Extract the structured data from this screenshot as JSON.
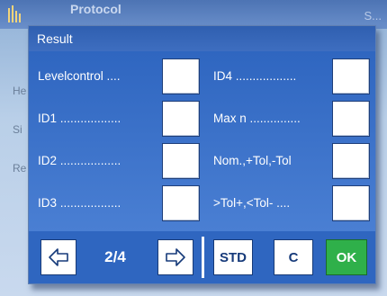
{
  "background_app": {
    "title": "Protocol",
    "title_right": "S...",
    "rows": [
      "He",
      "Si",
      "Re"
    ]
  },
  "dialog": {
    "title": "Result",
    "params_left": [
      {
        "label": "Levelcontrol ....",
        "checked": false
      },
      {
        "label": "ID1 ..................",
        "checked": false
      },
      {
        "label": "ID2 ..................",
        "checked": false
      },
      {
        "label": "ID3 ..................",
        "checked": false
      }
    ],
    "params_right": [
      {
        "label": "ID4 ..................",
        "checked": false
      },
      {
        "label": "Max n ...............",
        "checked": false
      },
      {
        "label": "Nom.,+Tol,-Tol",
        "checked": false
      },
      {
        "label": ">Tol+,<Tol- ....",
        "checked": false
      }
    ],
    "footer": {
      "page": "2/4",
      "prev_icon": "arrow-left-icon",
      "next_icon": "arrow-right-icon",
      "std_label": "STD",
      "c_label": "C",
      "ok_label": "OK"
    }
  },
  "colors": {
    "dialog_blue": "#2f66c0",
    "ok_green": "#2fb04a"
  }
}
